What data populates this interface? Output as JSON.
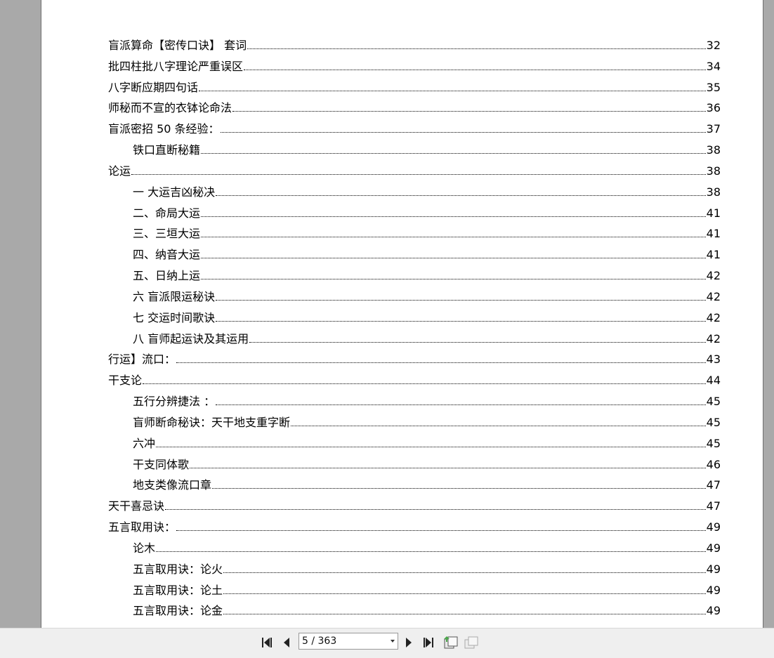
{
  "toc": [
    {
      "title": "盲派算命【密传口诀】  套词",
      "page": "32",
      "level": 1
    },
    {
      "title": "批四柱批八字理论严重误区",
      "page": "34",
      "level": 1
    },
    {
      "title": "八字断应期四句话",
      "page": "35",
      "level": 1
    },
    {
      "title": "师秘而不宣的衣钵论命法",
      "page": "36",
      "level": 1
    },
    {
      "title": "盲派密招 50 条经验：",
      "page": "37",
      "level": 1
    },
    {
      "title": "铁口直断秘籍",
      "page": "38",
      "level": 2
    },
    {
      "title": "论运",
      "page": "38",
      "level": 1
    },
    {
      "title": "一   大运吉凶秘决",
      "page": "38",
      "level": 2
    },
    {
      "title": "二、命局大运",
      "page": "41",
      "level": 2
    },
    {
      "title": "三、三垣大运",
      "page": "41",
      "level": 2
    },
    {
      "title": "四、纳音大运",
      "page": "41",
      "level": 2
    },
    {
      "title": "五、日纳上运",
      "page": "42",
      "level": 2
    },
    {
      "title": "六  盲派限运秘诀",
      "page": "42",
      "level": 2
    },
    {
      "title": "七  交运时间歌诀",
      "page": "42",
      "level": 2
    },
    {
      "title": "八   盲师起运诀及其运用",
      "page": "42",
      "level": 2
    },
    {
      "title": "行运】流口：",
      "page": "43",
      "level": 1
    },
    {
      "title": "干支论",
      "page": "44",
      "level": 1
    },
    {
      "title": "五行分辨捷法   ：",
      "page": "45",
      "level": 2
    },
    {
      "title": "盲师断命秘诀：天干地支重字断",
      "page": "45",
      "level": 2
    },
    {
      "title": "六冲",
      "page": "45",
      "level": 2
    },
    {
      "title": "干支同体歌",
      "page": "46",
      "level": 2
    },
    {
      "title": "地支类像流口章",
      "page": "47",
      "level": 2
    },
    {
      "title": "天干喜忌诀",
      "page": "47",
      "level": 1
    },
    {
      "title": "五言取用诀：",
      "page": "49",
      "level": 1
    },
    {
      "title": "论木",
      "page": "49",
      "level": 2
    },
    {
      "title": "五言取用诀：论火",
      "page": "49",
      "level": 2
    },
    {
      "title": "五言取用诀：论土",
      "page": "49",
      "level": 2
    },
    {
      "title": "五言取用诀：论金",
      "page": "49",
      "level": 2
    }
  ],
  "toolbar": {
    "page_indicator": "5 / 363",
    "icons": [
      "first-page-icon",
      "previous-page-icon",
      "next-page-icon",
      "last-page-icon",
      "single-page-view-icon",
      "multi-page-view-icon"
    ]
  },
  "colors": {
    "viewer_bg": "#a9a9a9",
    "page_bg": "#ffffff",
    "toolbar_bg": "#efefef",
    "icon_color": "#222222",
    "view_icon_accent": "#4aa84a"
  }
}
